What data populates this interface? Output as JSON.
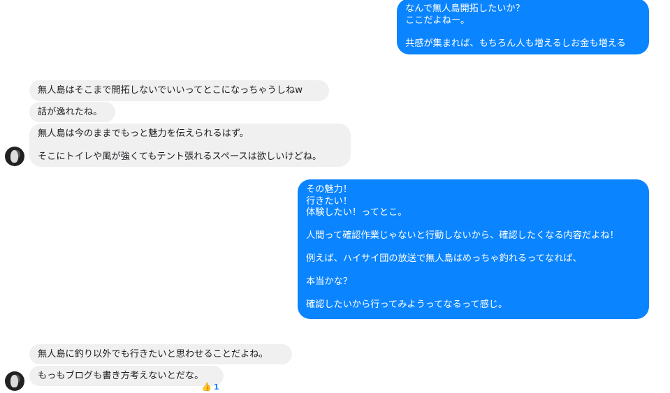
{
  "messages": [
    {
      "side": "out",
      "lines": [
        "なんで無人島開拓したいか？",
        "ここだよねー。",
        "",
        "共感が集まれば、もちろん人も増えるしお金も増える"
      ]
    },
    {
      "side": "in",
      "lines": [
        "無人島はそこまで開拓しないでいいってとこになっちゃうしねw"
      ]
    },
    {
      "side": "in",
      "lines": [
        "話が逸れたね。"
      ]
    },
    {
      "side": "in",
      "lines": [
        "無人島は今のままでもっと魅力を伝えられるはず。",
        "",
        "そこにトイレや風が強くてもテント張れるスペースは欲しいけどね。"
      ]
    },
    {
      "side": "out",
      "lines": [
        "その魅力！",
        "行きたい！",
        "体験したい！ってとこ。",
        "",
        "人間って確認作業じゃないと行動しないから、確認したくなる内容だよね！",
        "",
        "例えば、ハイサイ団の放送で無人島はめっちゃ釣れるってなれば、",
        "",
        "本当かな？",
        "",
        "確認したいから行ってみようってなるって感じ。"
      ]
    },
    {
      "side": "in",
      "lines": [
        "無人島に釣り以外でも行きたいと思わせることだよね。"
      ]
    },
    {
      "side": "in",
      "lines": [
        "もっもブログも書き方考えないとだな。"
      ]
    }
  ],
  "reaction": {
    "icon": "thumbs-up-icon",
    "emoji": "👍",
    "count": "1"
  },
  "colors": {
    "outgoing": "#0a84ff",
    "incoming": "#f1f0f0"
  }
}
